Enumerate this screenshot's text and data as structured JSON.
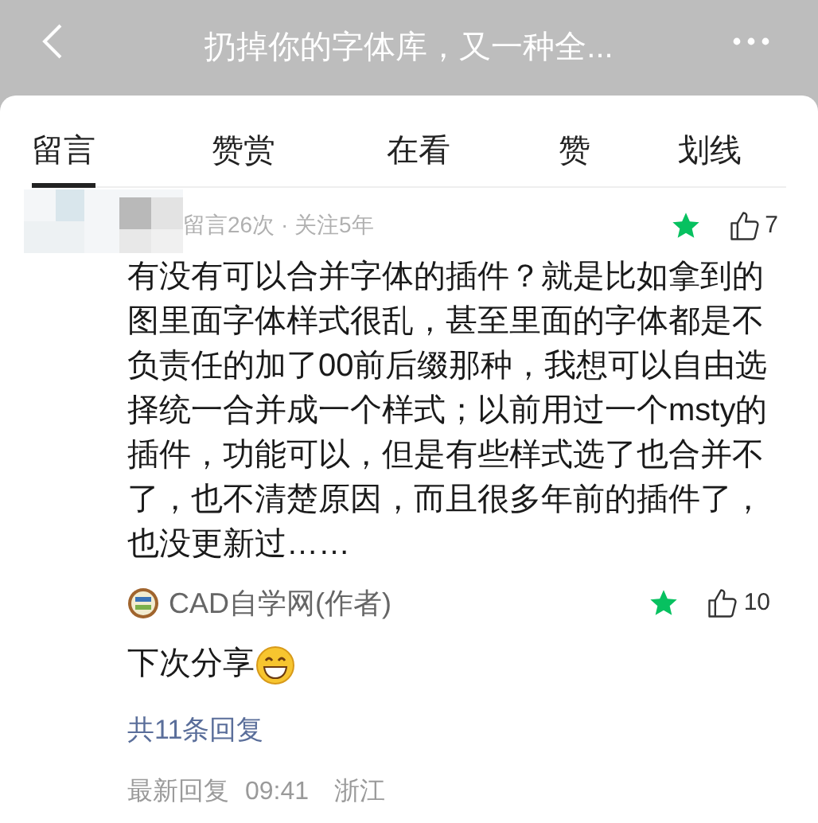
{
  "header": {
    "title": "扔掉你的字体库，又一种全..."
  },
  "tabs": [
    {
      "label": "留言",
      "selected": true
    },
    {
      "label": "赞赏",
      "selected": false
    },
    {
      "label": "在看",
      "selected": false
    },
    {
      "label": "赞",
      "selected": false
    },
    {
      "label": "划线",
      "selected": false
    }
  ],
  "comment": {
    "meta": "留言26次 · 关注5年",
    "starred": true,
    "likes": "7",
    "text": "有没有可以合并字体的插件？就是比如拿到的图里面字体样式很乱，甚至里面的字体都是不负责任的加了00前后缀那种，我想可以自由选择统一合并成一个样式；以前用过一个msty的插件，功能可以，但是有些样式选了也合并不了，也不清楚原因，而且很多年前的插件了，也没更新过……",
    "reply": {
      "author": "CAD自学网(作者)",
      "starred": true,
      "likes": "10",
      "text": "下次分享"
    },
    "reply_count": "共11条回复",
    "latest": [
      "最新回复",
      "09:41",
      "浙江"
    ]
  }
}
